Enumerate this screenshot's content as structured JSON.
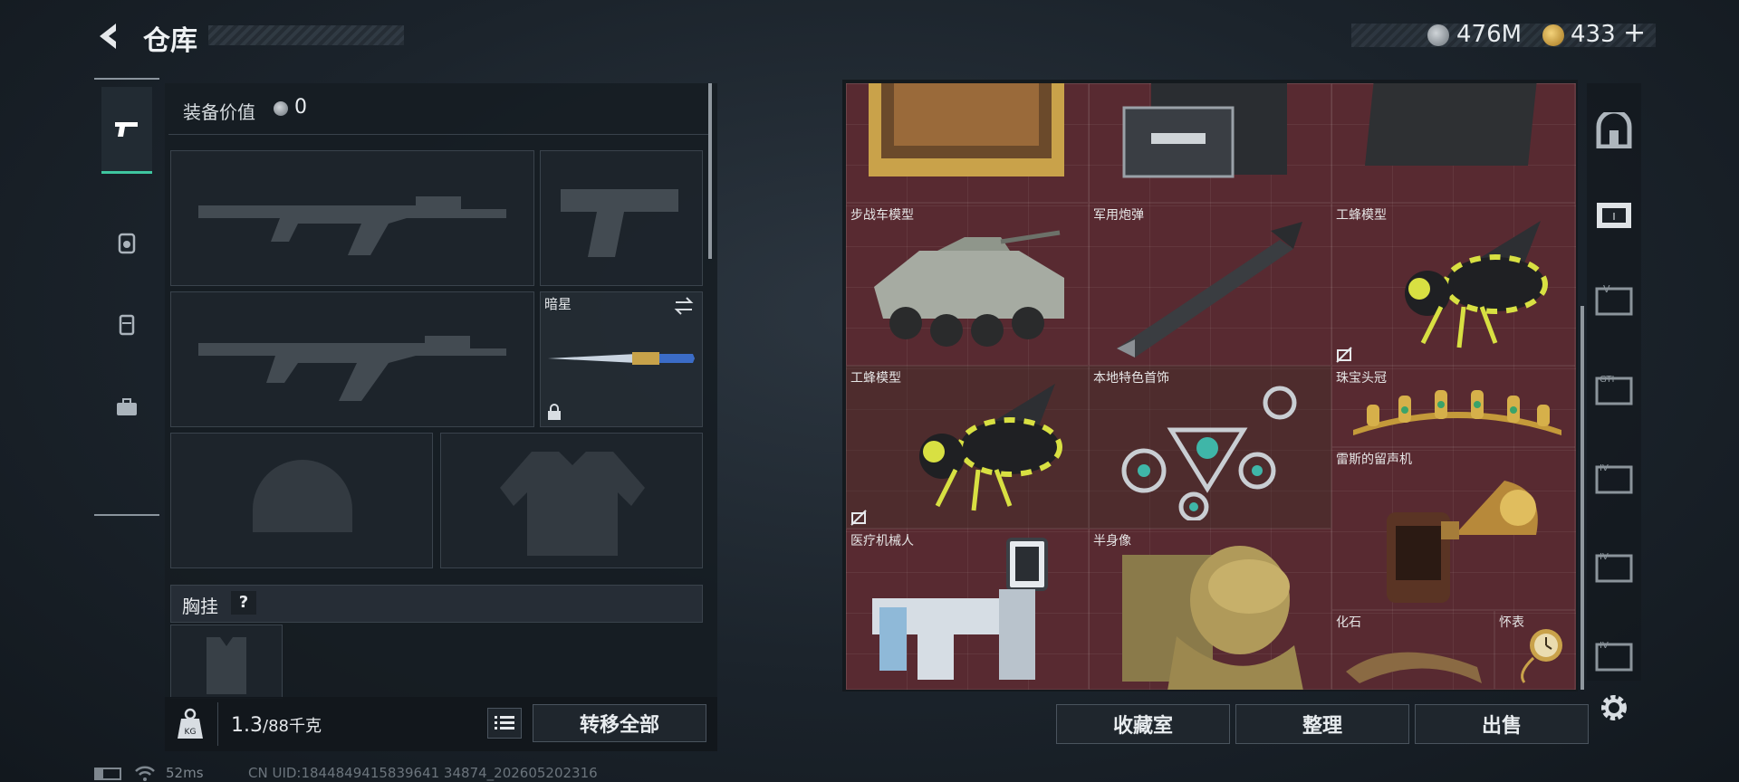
{
  "header": {
    "title": "仓库",
    "currency_1": "476M",
    "currency_2": "433",
    "currency_2_plus": "+"
  },
  "left": {
    "equip_value_label": "装备价值",
    "equip_value": "0",
    "melee_name": "暗星",
    "chest_rig_label": "胸挂",
    "chest_rig_help": "?",
    "weight_current": "1.3",
    "weight_max": "/88千克",
    "transfer_all": "转移全部"
  },
  "stash": {
    "items": [
      {
        "label": "步战车模型"
      },
      {
        "label": "军用炮弹"
      },
      {
        "label": "工蜂模型"
      },
      {
        "label": "工蜂模型"
      },
      {
        "label": "本地特色首饰"
      },
      {
        "label": "珠宝头冠"
      },
      {
        "label": "雷斯的留声机"
      },
      {
        "label": "医疗机械人"
      },
      {
        "label": "半身像"
      },
      {
        "label": "化石"
      },
      {
        "label": "怀表"
      }
    ],
    "buttons": {
      "collection": "收藏室",
      "sort": "整理",
      "sell": "出售"
    },
    "right_tabs": [
      "",
      "",
      "V",
      "GTI",
      "IV",
      "IV",
      "IV"
    ]
  },
  "status": {
    "ping": "52ms",
    "uid": "CN UID:1844849415839641 34874_202605202316"
  },
  "colors": {
    "grid_bg": "#5a2a31",
    "accent_green": "#3fc6a0"
  }
}
